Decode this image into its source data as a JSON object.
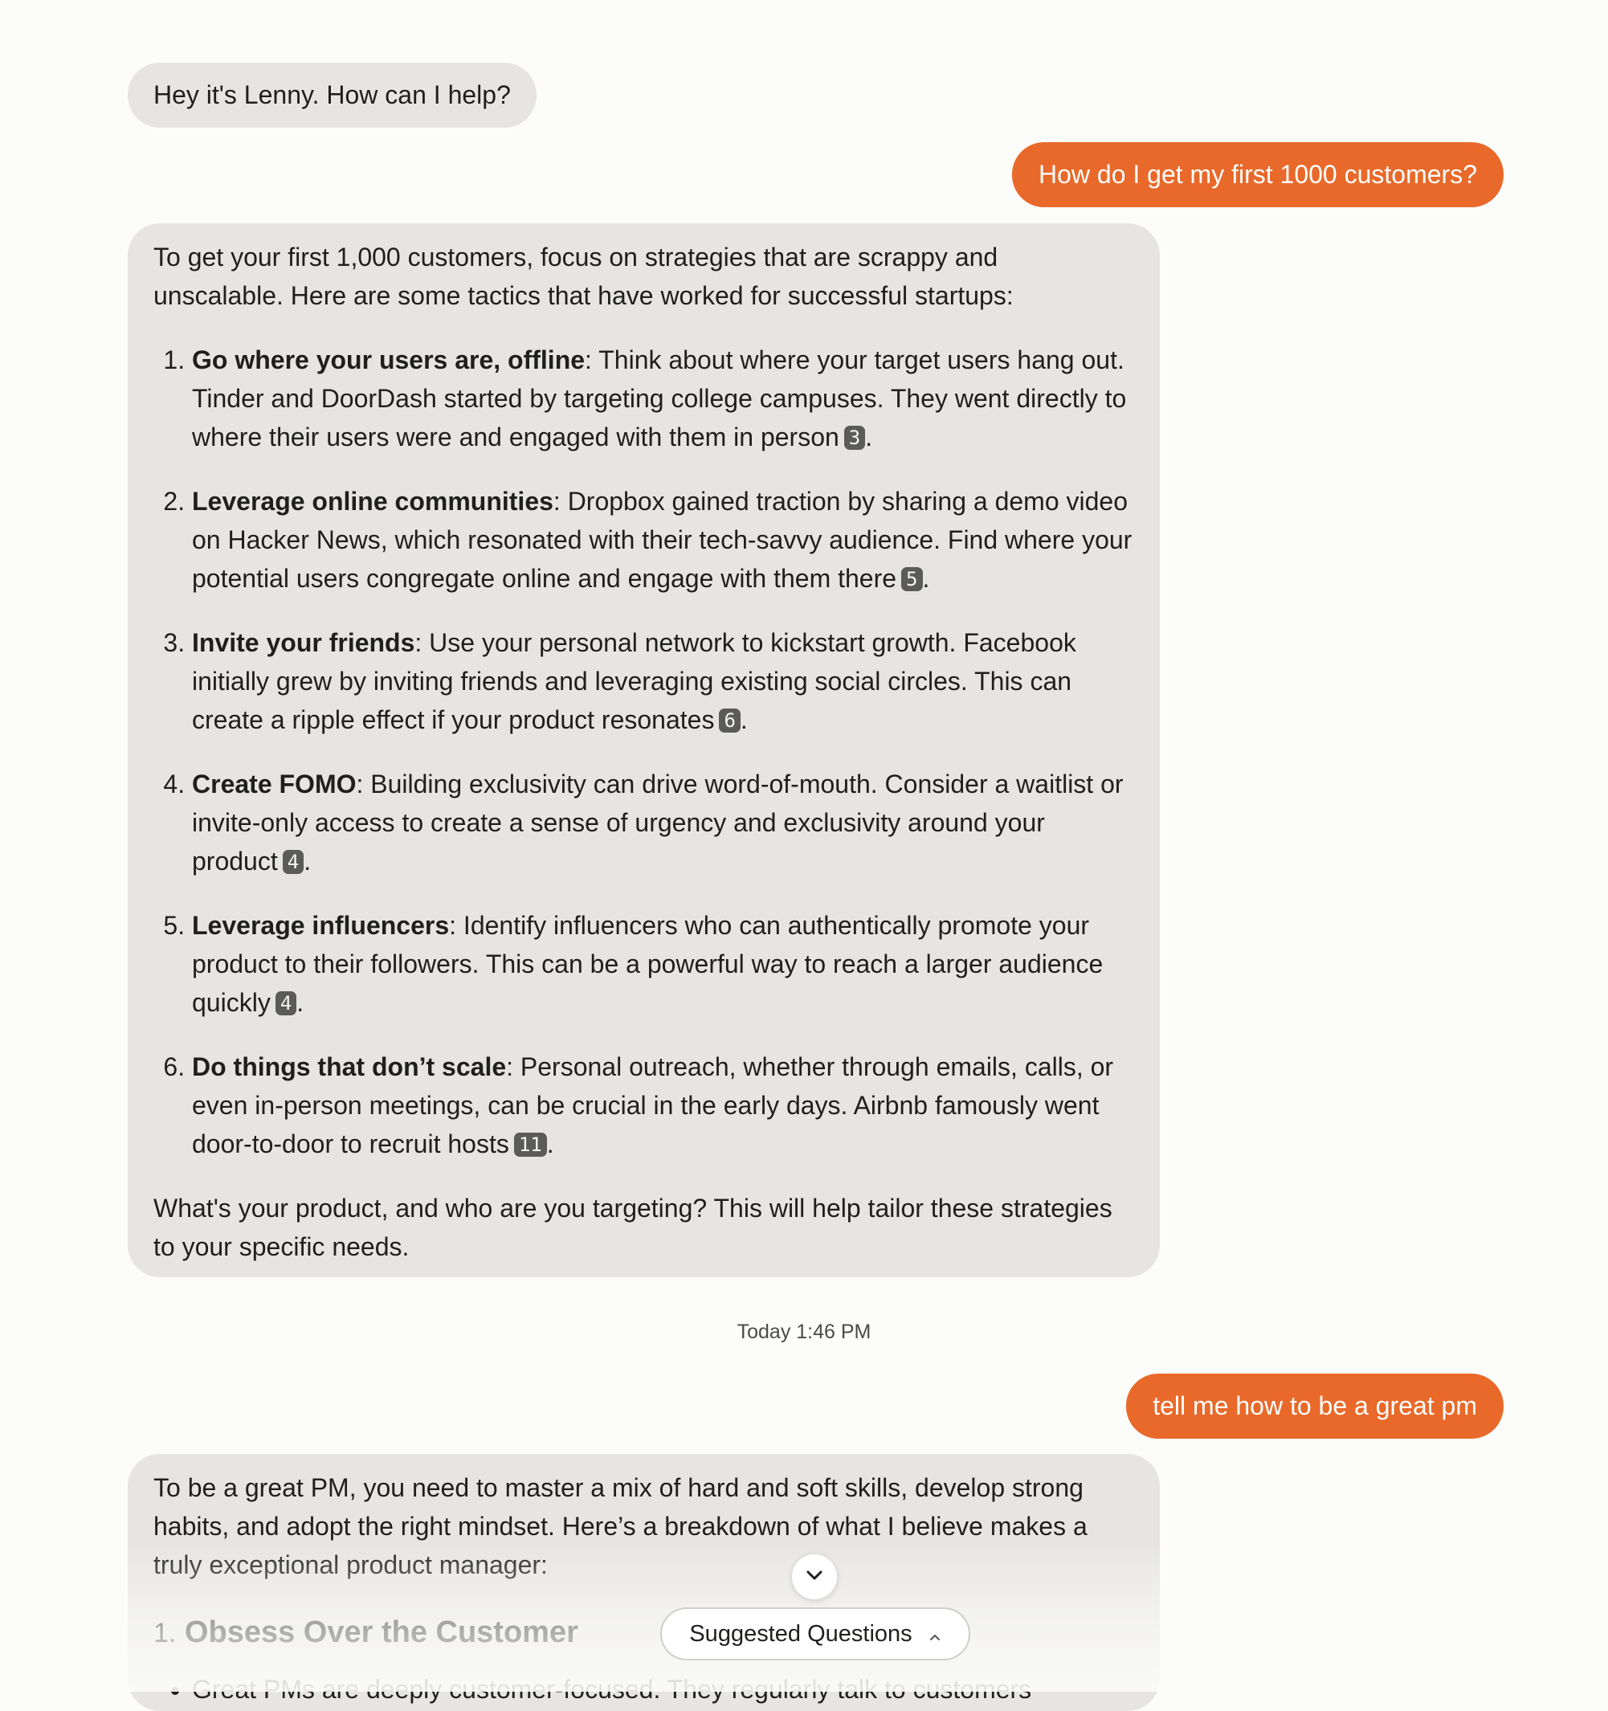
{
  "greeting": "Hey it's Lenny. How can I help?",
  "messages": {
    "user1": "How do I get my first 1000 customers?",
    "assistant1": {
      "intro": "To get your first 1,000 customers, focus on strategies that are scrappy and unscalable. Here are some tactics that have worked for successful startups:",
      "items": [
        {
          "title": "Go where your users are, offline",
          "text": ": Think about where your target users hang out. Tinder and DoorDash started by targeting college campuses. They went directly to where their users were and engaged with them in person",
          "cite": "3"
        },
        {
          "title": "Leverage online communities",
          "text": ": Dropbox gained traction by sharing a demo video on Hacker News, which resonated with their tech-savvy audience. Find where your potential users congregate online and engage with them there",
          "cite": "5"
        },
        {
          "title": "Invite your friends",
          "text": ": Use your personal network to kickstart growth. Facebook initially grew by inviting friends and leveraging existing social circles. This can create a ripple effect if your product resonates",
          "cite": "6"
        },
        {
          "title": "Create FOMO",
          "text": ": Building exclusivity can drive word-of-mouth. Consider a waitlist or invite-only access to create a sense of urgency and exclusivity around your product",
          "cite": "4"
        },
        {
          "title": "Leverage influencers",
          "text": ": Identify influencers who can authentically promote your product to their followers. This can be a powerful way to reach a larger audience quickly",
          "cite": "4"
        },
        {
          "title": "Do things that don’t scale",
          "text": ": Personal outreach, whether through emails, calls, or even in-person meetings, can be crucial in the early days. Airbnb famously went door-to-door to recruit hosts",
          "cite": "11"
        }
      ],
      "outro": "What's your product, and who are you targeting? This will help tailor these strategies to your specific needs."
    },
    "timestamp": "Today 1:46 PM",
    "user2": "tell me how to be a great pm",
    "assistant2": {
      "intro": "To be a great PM, you need to master a mix of hard and soft skills, develop strong habits, and adopt the right mindset. Here’s a breakdown of what I believe makes a truly exceptional product manager:",
      "heading_num": "1.",
      "heading": "Obsess Over the Customer",
      "bullet": "Great PMs are deeply customer-focused. They regularly talk to customers"
    }
  },
  "controls": {
    "scroll_icon": "chevron-down-icon",
    "suggested_label": "Suggested Questions",
    "suggested_icon": "chevron-up-icon"
  },
  "colors": {
    "user_bubble": "#e8692a",
    "assistant_bubble": "#e6e5e2",
    "citation_badge": "#5b5b58"
  }
}
